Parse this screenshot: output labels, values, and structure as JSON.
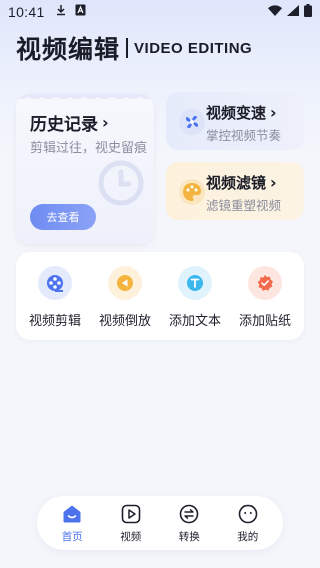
{
  "status_bar": {
    "time": "10:41",
    "icons": [
      "download-icon",
      "a-box-icon",
      "wifi-icon",
      "signal-icon",
      "battery-icon"
    ]
  },
  "header": {
    "title": "视频编辑",
    "subtitle": "VIDEO EDITING"
  },
  "history_card": {
    "title": "历史记录",
    "description": "剪辑过往，视史留痕",
    "button_label": "去查看",
    "icon": "history-clock-icon"
  },
  "feature_cards": [
    {
      "title": "视频变速",
      "subtitle": "掌控视频节奏",
      "icon": "fan-speed-icon",
      "accent": "#4d72ee"
    },
    {
      "title": "视频滤镜",
      "subtitle": "滤镜重塑视频",
      "icon": "palette-icon",
      "accent": "#f3b53f"
    }
  ],
  "tools": [
    {
      "label": "视频剪辑",
      "icon": "film-reel-icon",
      "color": "#4d72ee",
      "bg": "#e3eafc"
    },
    {
      "label": "视频倒放",
      "icon": "rewind-icon",
      "color": "#f3b53f",
      "bg": "#fdf1dc"
    },
    {
      "label": "添加文本",
      "icon": "text-icon",
      "color": "#3bb7ee",
      "bg": "#e0f3fc"
    },
    {
      "label": "添加贴纸",
      "icon": "sticker-badge-icon",
      "color": "#f26b4d",
      "bg": "#fde6e0"
    }
  ],
  "bottom_nav": [
    {
      "label": "首页",
      "icon": "home-icon",
      "active": true
    },
    {
      "label": "视频",
      "icon": "video-play-icon",
      "active": false
    },
    {
      "label": "转换",
      "icon": "convert-icon",
      "active": false
    },
    {
      "label": "我的",
      "icon": "profile-smile-icon",
      "active": false
    }
  ],
  "colors": {
    "accent": "#4d72ee",
    "text_primary": "#1a1c28",
    "text_secondary": "#8a8e9e"
  }
}
